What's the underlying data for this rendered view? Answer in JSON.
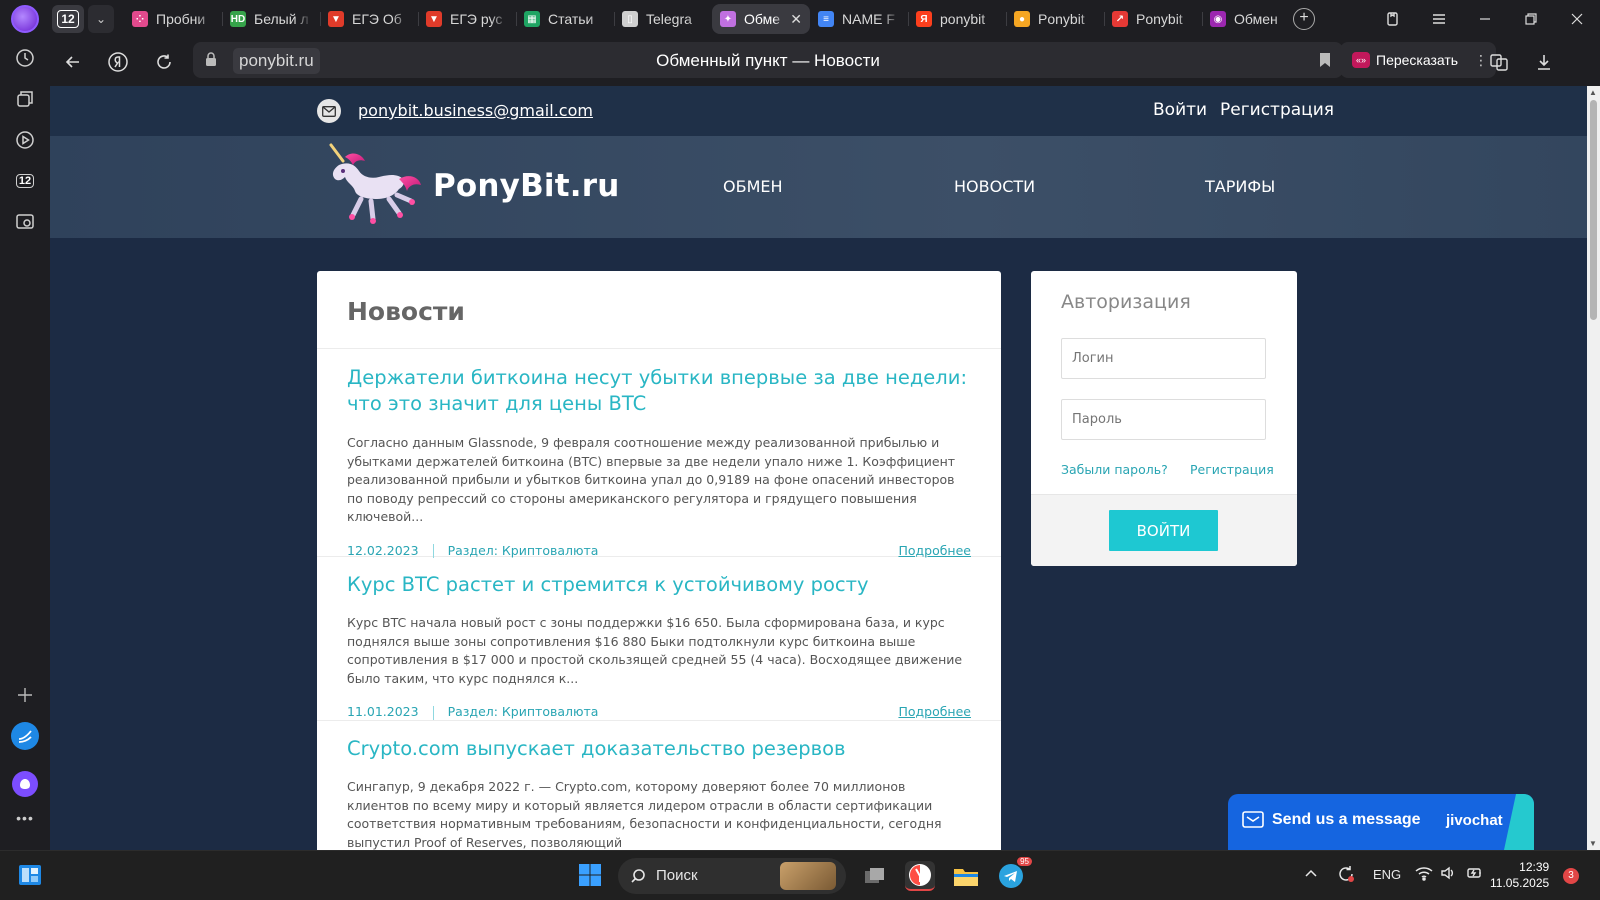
{
  "browser": {
    "tab_count": "12",
    "tabs": [
      {
        "label": "Пробни",
        "icon": "dots-icon",
        "color": "#e24a8d"
      },
      {
        "label": "Белый л",
        "icon": "hd-icon",
        "color": "#36a34a"
      },
      {
        "label": "ЕГЭ Об",
        "icon": "shield-icon",
        "color": "#e03b2a"
      },
      {
        "label": "ЕГЭ рус",
        "icon": "shield-icon",
        "color": "#e03b2a"
      },
      {
        "label": "Статьи",
        "icon": "sheets-icon",
        "color": "#1fa463"
      },
      {
        "label": "Telegra",
        "icon": "page-icon",
        "color": "#cfcfcf"
      },
      {
        "label": "Обме",
        "icon": "unicorn-icon",
        "color": "#c070e0",
        "active": true
      },
      {
        "label": "NAME F",
        "icon": "docs-icon",
        "color": "#4285f4"
      },
      {
        "label": "ponybit",
        "icon": "yandex-icon",
        "color": "#fc3f1d"
      },
      {
        "label": "Ponybit",
        "icon": "github-icon",
        "color": "#f5a623"
      },
      {
        "label": "Ponybit",
        "icon": "chart-icon",
        "color": "#e53935"
      },
      {
        "label": "Обмен",
        "icon": "purple-circle-icon",
        "color": "#9c27b0"
      }
    ],
    "url": "ponybit.ru",
    "page_title": "Обменный пункт — Новости",
    "retell_label": "Пересказать",
    "retell_badge": "«»"
  },
  "site": {
    "email": "ponybit.business@gmail.com",
    "login_link": "Войти",
    "register_link": "Регистрация",
    "logo_text": "PonyBit.ru",
    "nav": [
      "ОБМЕН",
      "НОВОСТИ",
      "ТАРИФЫ"
    ]
  },
  "news": {
    "heading": "Новости",
    "items": [
      {
        "title": "Держатели биткоина несут убытки впервые за две недели: что это значит для цены BTC",
        "text": "Согласно данным Glassnode, 9 февраля соотношение между реализованной прибылью и убытками держателей биткоина (BTC) впервые за две недели упало ниже 1. Коэффициент реализованной прибыли и убытков биткоина упал до 0,9189 на фоне опасений инвесторов по поводу репрессий со стороны американского регулятора и грядущего повышения ключевой...",
        "date": "12.02.2023",
        "section": "Раздел: Криптовалюта",
        "more": "Подробнее"
      },
      {
        "title": "Курс BTC растет и стремится к устойчивому росту",
        "text": "Курс BTC начала новый рост с зоны поддержки $16 650. Была сформирована база, и курс поднялся выше зоны сопротивления $16 880 Быки подтолкнули курс биткоина выше сопротивления в $17 000 и простой скользящей средней 55 (4 часа). Восходящее движение было таким, что курс поднялся к...",
        "date": "11.01.2023",
        "section": "Раздел: Криптовалюта",
        "more": "Подробнее"
      },
      {
        "title": "Crypto.com выпускает доказательство резервов",
        "text": "Сингапур, 9 декабря 2022 г. — Crypto.com, которому доверяют более 70 миллионов клиентов по всему миру и который является лидером отрасли в области сертификации соответствия нормативным требованиям, безопасности и конфиденциальности, сегодня выпустил Proof of Reserves, позволяющий",
        "date": "",
        "section": "",
        "more": ""
      }
    ]
  },
  "auth": {
    "heading": "Авторизация",
    "login_placeholder": "Логин",
    "password_placeholder": "Пароль",
    "forgot_link": "Забыли пароль?",
    "register_link": "Регистрация",
    "submit": "ВОЙТИ"
  },
  "chat": {
    "label": "Send us a message",
    "brand": "jivochat"
  },
  "taskbar": {
    "search_label": "Поиск",
    "lang": "ENG",
    "time": "12:39",
    "date": "11.05.2025",
    "notification_count": "3",
    "telegram_badge": "95"
  },
  "colors": {
    "accent_teal": "#1ec8d2",
    "link_teal": "#29b6c4",
    "site_bg": "#1c2b44",
    "chat_blue": "#1565e0"
  }
}
